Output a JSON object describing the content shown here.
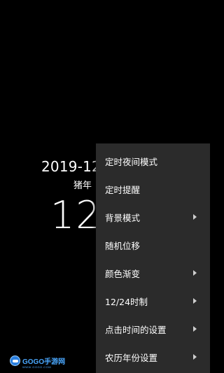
{
  "clock": {
    "date": "2019-12",
    "lunar": "猪年",
    "time": "12"
  },
  "menu": {
    "items": [
      {
        "label": "定时夜间模式",
        "submenu": false
      },
      {
        "label": "定时提醒",
        "submenu": false
      },
      {
        "label": "背景模式",
        "submenu": true
      },
      {
        "label": "随机位移",
        "submenu": false
      },
      {
        "label": "颜色渐变",
        "submenu": true
      },
      {
        "label": "12/24时制",
        "submenu": true
      },
      {
        "label": "点击时间的设置",
        "submenu": true
      },
      {
        "label": "农历年份设置",
        "submenu": true
      }
    ]
  },
  "watermark": {
    "brand": "GOGO手游网",
    "sub": "WWW.GOGO.COM"
  },
  "colors": {
    "background": "#000000",
    "menu_background": "#2b2b2b",
    "text": "#ffffff",
    "watermark_accent": "#2a7fe0"
  },
  "icons": {
    "submenu": "chevron-right-icon",
    "watermark": "gogo-logo-icon"
  }
}
